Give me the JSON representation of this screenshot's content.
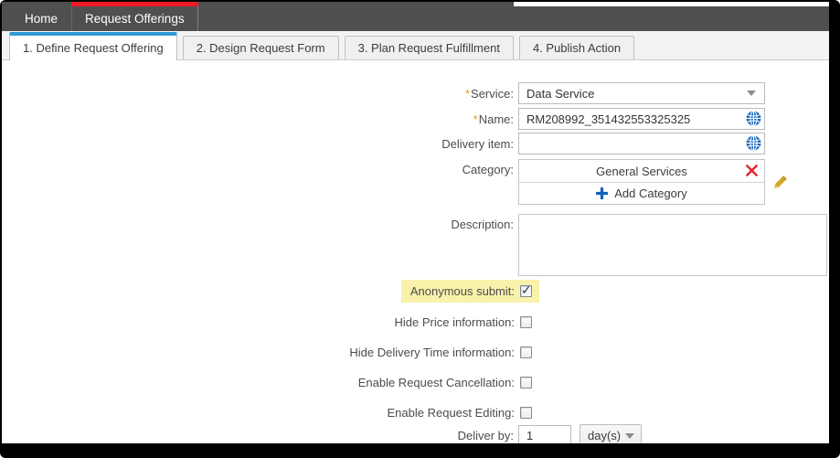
{
  "colors": {
    "topbar_bg": "#4f4f4f",
    "active_nav_accent": "#ed1b24",
    "active_tab_accent": "#2e9bd6",
    "highlight_yellow": "#f9f2ab",
    "required_asterisk": "#e8991c",
    "globe_blue": "#1c6dc2",
    "remove_red": "#e3242b",
    "pencil_gold": "#d5a428",
    "plus_blue": "#1461ba"
  },
  "topnav": {
    "items": [
      {
        "label": "Home",
        "active": false
      },
      {
        "label": "Request Offerings",
        "active": true
      }
    ]
  },
  "wizard_tabs": [
    {
      "label": "1. Define Request Offering",
      "active": true
    },
    {
      "label": "2. Design Request Form",
      "active": false
    },
    {
      "label": "3. Plan Request Fulfillment",
      "active": false
    },
    {
      "label": "4. Publish Action",
      "active": false
    }
  ],
  "form": {
    "service": {
      "required_mark": "*",
      "label": "Service:",
      "value": "Data Service"
    },
    "name": {
      "required_mark": "*",
      "label": "Name:",
      "value": "RM208992_351432553325325"
    },
    "delivery_item": {
      "label": "Delivery item:",
      "value": ""
    },
    "category": {
      "label": "Category:",
      "items": [
        "General Services"
      ],
      "add_label": "Add Category"
    },
    "description": {
      "label": "Description:",
      "value": ""
    },
    "checkboxes": [
      {
        "label": "Anonymous submit:",
        "checked": true,
        "highlighted": true
      },
      {
        "label": "Hide Price information:",
        "checked": false
      },
      {
        "label": "Hide Delivery Time information:",
        "checked": false
      },
      {
        "label": "Enable Request Cancellation:",
        "checked": false
      },
      {
        "label": "Enable Request Editing:",
        "checked": false
      }
    ],
    "deliver_by": {
      "label": "Deliver by:",
      "value": "1",
      "unit": "day(s)"
    }
  }
}
